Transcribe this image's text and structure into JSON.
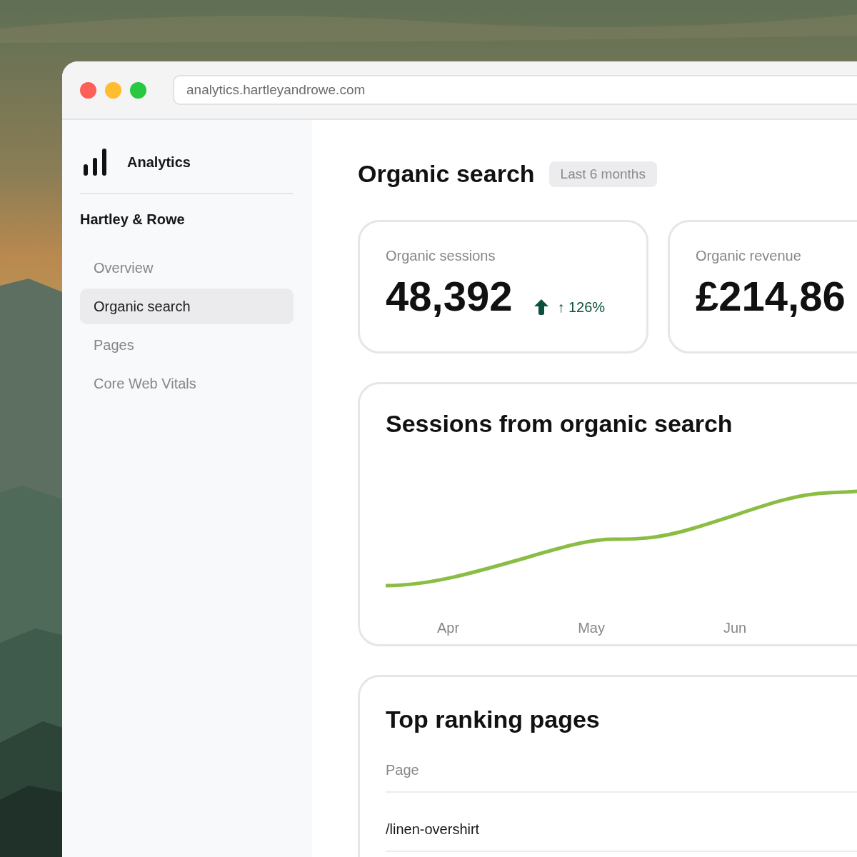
{
  "browser": {
    "url": "analytics.hartleyandrowe.com"
  },
  "sidebar": {
    "app_name": "Analytics",
    "workspace": "Hartley & Rowe",
    "items": [
      {
        "label": "Overview",
        "selected": false
      },
      {
        "label": "Organic search",
        "selected": true
      },
      {
        "label": "Pages",
        "selected": false
      },
      {
        "label": "Core Web Vitals",
        "selected": false
      }
    ]
  },
  "header": {
    "title": "Organic search",
    "range": "Last 6 months"
  },
  "metrics": [
    {
      "label": "Organic sessions",
      "value": "48,392",
      "delta": "↑ 126%"
    },
    {
      "label": "Organic revenue",
      "value": "£214,86"
    }
  ],
  "sessions_chart": {
    "title": "Sessions from organic search",
    "x_labels": [
      "Apr",
      "May",
      "Jun"
    ]
  },
  "top_pages": {
    "title": "Top ranking pages",
    "columns": [
      "Page"
    ],
    "rows": [
      [
        "/linen-overshirt"
      ]
    ]
  }
}
